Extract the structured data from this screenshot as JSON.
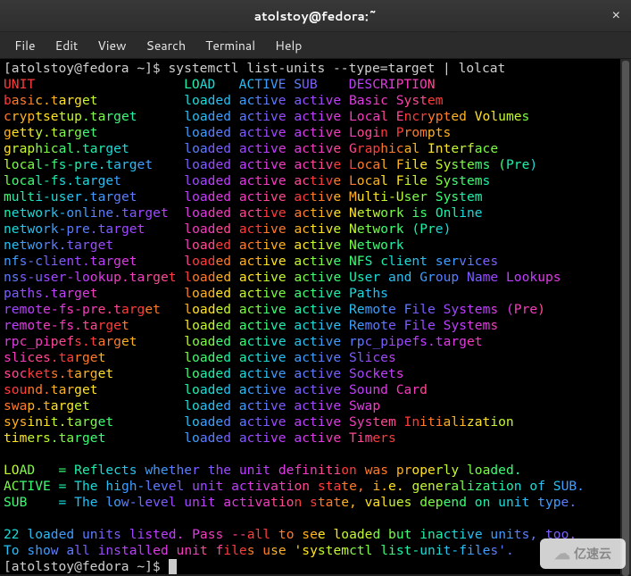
{
  "window": {
    "title": "atolstoy@fedora:~",
    "close_glyph": "×"
  },
  "menu": [
    "File",
    "Edit",
    "View",
    "Search",
    "Terminal",
    "Help"
  ],
  "prompt1": {
    "text": "[atolstoy@fedora ~]$ ",
    "cmd": "systemctl list-units --type=target | lolcat"
  },
  "header": {
    "unit": "UNIT",
    "load": "LOAD",
    "active": "ACTIVE",
    "sub": "SUB",
    "desc": "DESCRIPTION"
  },
  "units": [
    {
      "unit": "basic.target",
      "load": "loaded",
      "active": "active",
      "sub": "active",
      "desc": "Basic System"
    },
    {
      "unit": "cryptsetup.target",
      "load": "loaded",
      "active": "active",
      "sub": "active",
      "desc": "Local Encrypted Volumes"
    },
    {
      "unit": "getty.target",
      "load": "loaded",
      "active": "active",
      "sub": "active",
      "desc": "Login Prompts"
    },
    {
      "unit": "graphical.target",
      "load": "loaded",
      "active": "active",
      "sub": "active",
      "desc": "Graphical Interface"
    },
    {
      "unit": "local-fs-pre.target",
      "load": "loaded",
      "active": "active",
      "sub": "active",
      "desc": "Local File Systems (Pre)"
    },
    {
      "unit": "local-fs.target",
      "load": "loaded",
      "active": "active",
      "sub": "active",
      "desc": "Local File Systems"
    },
    {
      "unit": "multi-user.target",
      "load": "loaded",
      "active": "active",
      "sub": "active",
      "desc": "Multi-User System"
    },
    {
      "unit": "network-online.target",
      "load": "loaded",
      "active": "active",
      "sub": "active",
      "desc": "Network is Online"
    },
    {
      "unit": "network-pre.target",
      "load": "loaded",
      "active": "active",
      "sub": "active",
      "desc": "Network (Pre)"
    },
    {
      "unit": "network.target",
      "load": "loaded",
      "active": "active",
      "sub": "active",
      "desc": "Network"
    },
    {
      "unit": "nfs-client.target",
      "load": "loaded",
      "active": "active",
      "sub": "active",
      "desc": "NFS client services"
    },
    {
      "unit": "nss-user-lookup.target",
      "load": "loaded",
      "active": "active",
      "sub": "active",
      "desc": "User and Group Name Lookups"
    },
    {
      "unit": "paths.target",
      "load": "loaded",
      "active": "active",
      "sub": "active",
      "desc": "Paths"
    },
    {
      "unit": "remote-fs-pre.target",
      "load": "loaded",
      "active": "active",
      "sub": "active",
      "desc": "Remote File Systems (Pre)"
    },
    {
      "unit": "remote-fs.target",
      "load": "loaded",
      "active": "active",
      "sub": "active",
      "desc": "Remote File Systems"
    },
    {
      "unit": "rpc_pipefs.target",
      "load": "loaded",
      "active": "active",
      "sub": "active",
      "desc": "rpc_pipefs.target"
    },
    {
      "unit": "slices.target",
      "load": "loaded",
      "active": "active",
      "sub": "active",
      "desc": "Slices"
    },
    {
      "unit": "sockets.target",
      "load": "loaded",
      "active": "active",
      "sub": "active",
      "desc": "Sockets"
    },
    {
      "unit": "sound.target",
      "load": "loaded",
      "active": "active",
      "sub": "active",
      "desc": "Sound Card"
    },
    {
      "unit": "swap.target",
      "load": "loaded",
      "active": "active",
      "sub": "active",
      "desc": "Swap"
    },
    {
      "unit": "sysinit.target",
      "load": "loaded",
      "active": "active",
      "sub": "active",
      "desc": "System Initialization"
    },
    {
      "unit": "timers.target",
      "load": "loaded",
      "active": "active",
      "sub": "active",
      "desc": "Timers"
    }
  ],
  "legend": [
    "LOAD   = Reflects whether the unit definition was properly loaded.",
    "ACTIVE = The high-level unit activation state, i.e. generalization of SUB.",
    "SUB    = The low-level unit activation state, values depend on unit type."
  ],
  "summary": [
    "22 loaded units listed. Pass --all to see loaded but inactive units, too.",
    "To show all installed unit files use 'systemctl list-unit-files'."
  ],
  "prompt2": "[atolstoy@fedora ~]$ ",
  "watermark": "亿速云",
  "colors_rainbow": [
    "#ff3b3b",
    "#ff7a2a",
    "#ffb21f",
    "#ffe323",
    "#c3f72e",
    "#7dfb46",
    "#3dfb74",
    "#1cf0aa",
    "#1adbd8",
    "#27bff4",
    "#3e9dff",
    "#5c7cff",
    "#7c5dff",
    "#9d49ff",
    "#bf3eff",
    "#df3be4",
    "#f53cbd",
    "#ff4893"
  ]
}
